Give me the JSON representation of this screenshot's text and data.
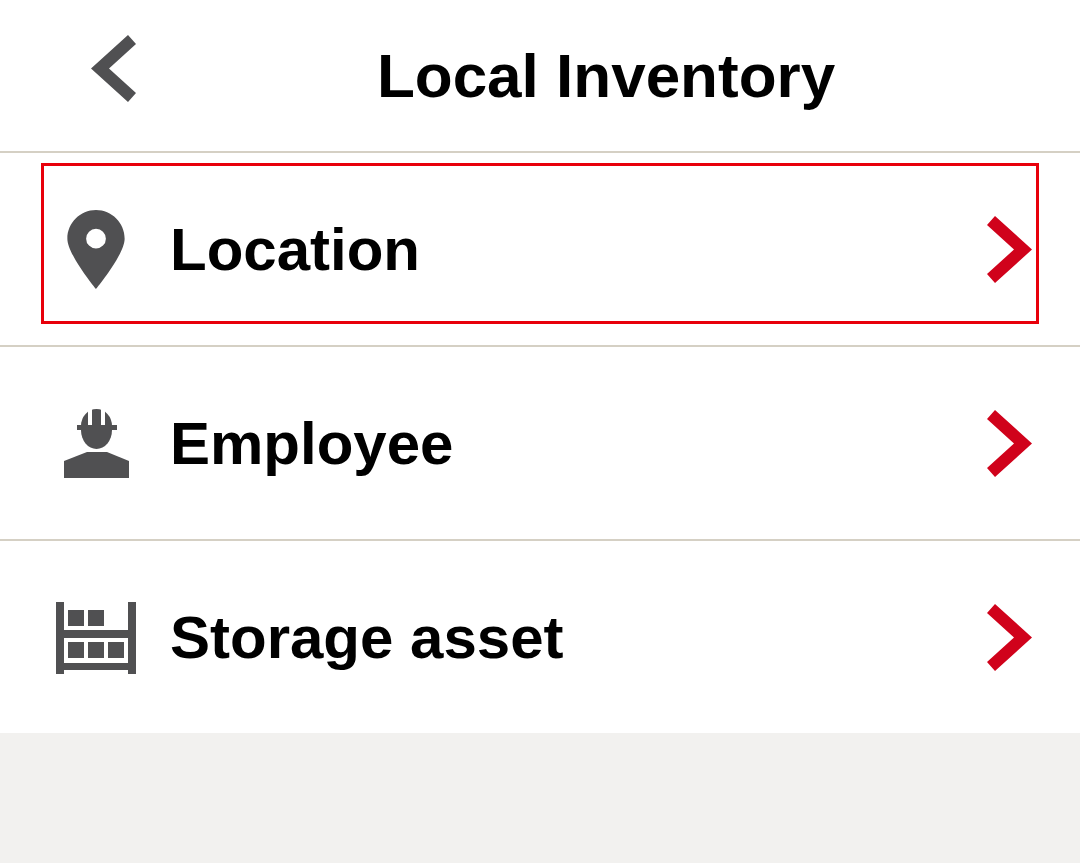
{
  "header": {
    "title": "Local Inventory"
  },
  "items": [
    {
      "label": "Location",
      "kind": "location",
      "selected": true
    },
    {
      "label": "Employee",
      "kind": "employee",
      "selected": false
    },
    {
      "label": "Storage asset",
      "kind": "storage",
      "selected": false
    }
  ]
}
